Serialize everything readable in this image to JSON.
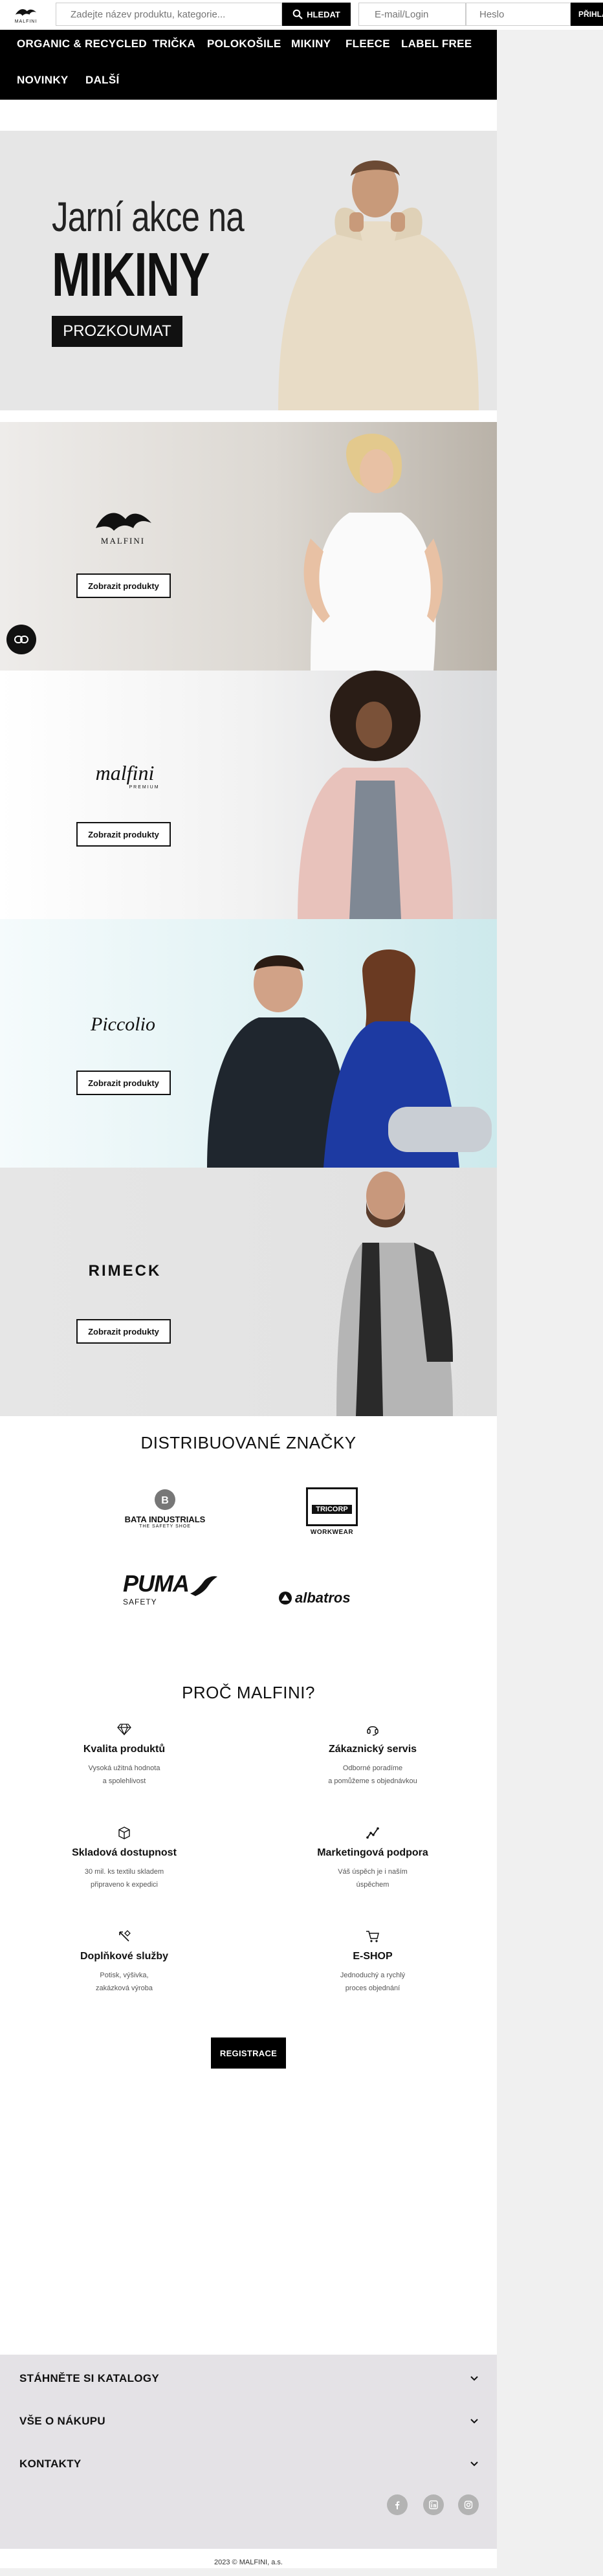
{
  "header": {
    "logo_text": "MALFINI",
    "search_placeholder": "Zadejte název produktu, kategorie...",
    "search_button": "HLEDAT",
    "login_placeholder": "E-mail/Login",
    "password_placeholder": "Heslo",
    "signin_button": "PŘIHLÁSIT"
  },
  "nav": {
    "items": [
      "ORGANIC & RECYCLED",
      "TRIČKA",
      "POLOKOŠILE",
      "MIKINY",
      "FLEECE",
      "LABEL FREE",
      "NOVINKY",
      "DALŠÍ"
    ]
  },
  "hero": {
    "line1": "Jarní akce na",
    "line2": "MIKINY",
    "cta": "PROZKOUMAT"
  },
  "panels": [
    {
      "brand": "MALFINI",
      "button": "Zobrazit produkty"
    },
    {
      "brand": "malfini",
      "brand_sub": "PREMIUM",
      "button": "Zobrazit produkty"
    },
    {
      "brand": "Piccolio",
      "button": "Zobrazit produkty"
    },
    {
      "brand": "RIMECK",
      "button": "Zobrazit produkty"
    }
  ],
  "brands": {
    "title": "DISTRIBUOVANÉ ZNAČKY",
    "logos": [
      {
        "name": "BATA INDUSTRIALS",
        "sub": "THE SAFETY SHOE"
      },
      {
        "name": "TRICORP",
        "sub": "WORKWEAR"
      },
      {
        "name": "PUMA",
        "sub": "SAFETY"
      },
      {
        "name": "albatros"
      }
    ]
  },
  "why": {
    "title": "PROČ MALFINI?",
    "items": [
      {
        "icon": "diamond-icon",
        "title": "Kvalita produktů",
        "desc1": "Vysoká užitná hodnota",
        "desc2": "a spolehlivost"
      },
      {
        "icon": "headset-icon",
        "title": "Zákaznický servis",
        "desc1": "Odborné poradíme",
        "desc2": "a pomůžeme s objednávkou"
      },
      {
        "icon": "box-icon",
        "title": "Skladová dostupnost",
        "desc1": "30 mil. ks textilu skladem",
        "desc2": "připraveno k expedici"
      },
      {
        "icon": "chart-icon",
        "title": "Marketingová podpora",
        "desc1": "Váš úspěch je i naším",
        "desc2": "úspěchem"
      },
      {
        "icon": "tools-icon",
        "title": "Doplňkové služby",
        "desc1": "Potisk, výšivka,",
        "desc2": "zakázková výroba"
      },
      {
        "icon": "cart-icon",
        "title": "E-SHOP",
        "desc1": "Jednoduchý a rychlý",
        "desc2": "proces objednání"
      }
    ],
    "register_button": "REGISTRACE"
  },
  "footer": {
    "accordions": [
      "STÁHNĚTE SI KATALOGY",
      "VŠE O NÁKUPU",
      "KONTAKTY"
    ],
    "social": [
      "facebook-icon",
      "linkedin-icon",
      "instagram-icon"
    ],
    "copyright": "2023 © MALFINI, a.s."
  }
}
